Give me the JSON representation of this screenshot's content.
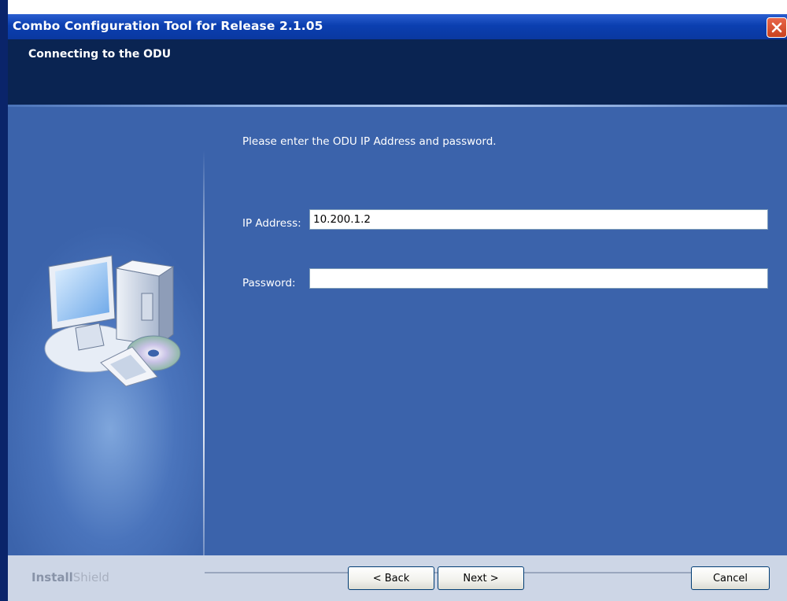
{
  "window": {
    "title": "Combo Configuration Tool for Release 2.1.05",
    "header_title": "Connecting to the ODU"
  },
  "content": {
    "prompt": "Please enter the ODU IP Address and password.",
    "ip_label": "IP Address:",
    "ip_value": "10.200.1.2",
    "password_label": "Password:",
    "password_value": ""
  },
  "footer": {
    "brand_part1": "Install",
    "brand_part2": "Shield",
    "back_label": "< Back",
    "next_label": "Next >",
    "cancel_label": "Cancel"
  },
  "icons": {
    "close": "close-icon",
    "computer": "computer-icon"
  },
  "colors": {
    "title_bar": "#0b3fb0",
    "header_band": "#0a2452",
    "main_background": "#3b63ab",
    "close_button": "#c9421f",
    "footer_background": "#cdd6e6"
  }
}
